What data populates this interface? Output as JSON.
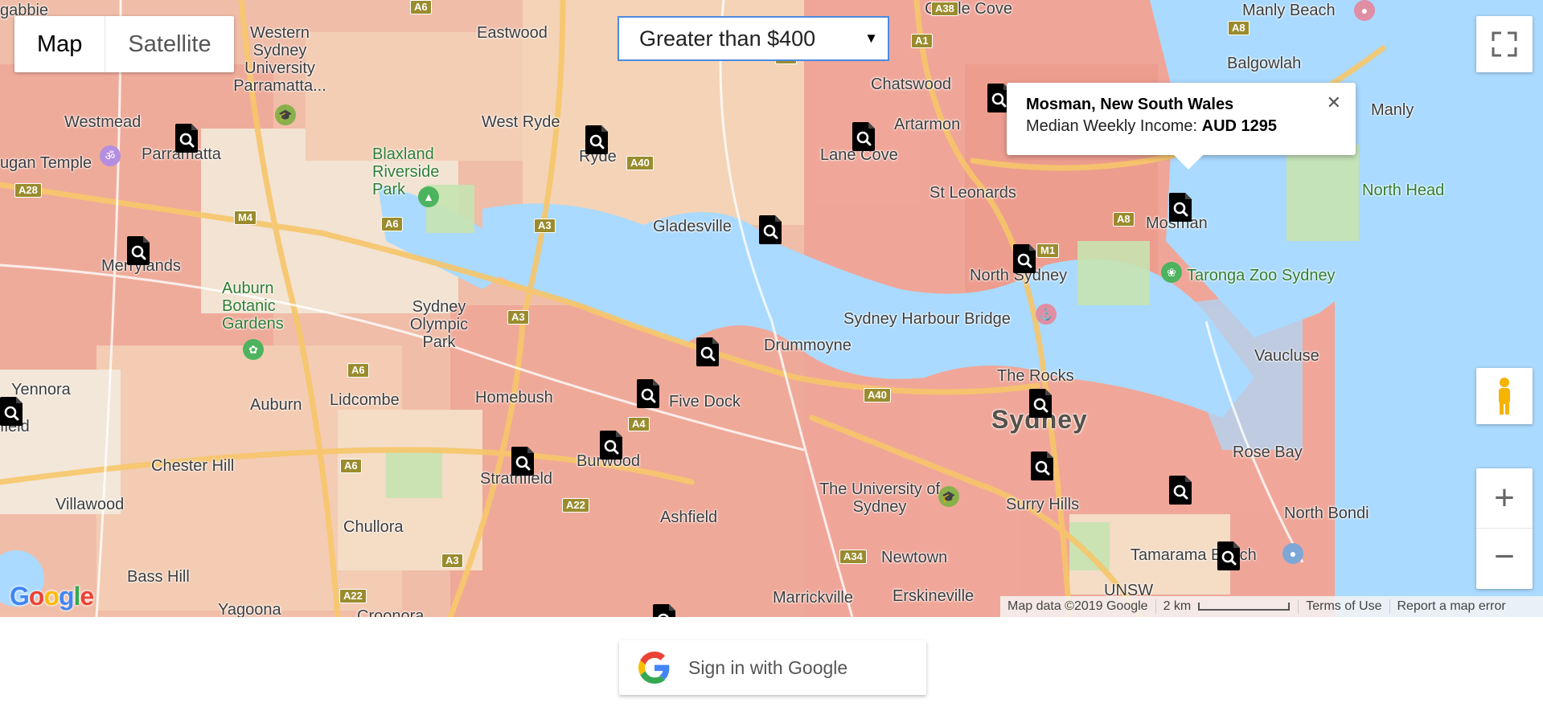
{
  "map_type_control": {
    "map_label": "Map",
    "satellite_label": "Satellite",
    "active": "Map"
  },
  "filter": {
    "selected": "Greater than $400"
  },
  "info_window": {
    "title": "Mosman, New South Wales",
    "income_label": "Median Weekly Income:",
    "income_value": "AUD 1295"
  },
  "attribution": {
    "map_data": "Map data ©2019 Google",
    "scale_label": "2 km",
    "terms": "Terms of Use",
    "report": "Report a map error"
  },
  "logo": "Google",
  "signin_label": "Sign in with Google",
  "colors": {
    "accent": "#4d8ae0",
    "high_income": "#ef9a8c",
    "water": "#aadaff"
  },
  "places": [
    {
      "name": "gabbie"
    },
    {
      "name": "Western Sydney University Parramatta..."
    },
    {
      "name": "Eastwood"
    },
    {
      "name": "Castle Cove"
    },
    {
      "name": "Manly Beach"
    },
    {
      "name": "Westmead"
    },
    {
      "name": "Parramatta"
    },
    {
      "name": "West Ryde"
    },
    {
      "name": "Ryde"
    },
    {
      "name": "Chatswood"
    },
    {
      "name": "Balgowlah"
    },
    {
      "name": "Manly"
    },
    {
      "name": "Artarmon"
    },
    {
      "name": "Lane Cove"
    },
    {
      "name": "Blaxland Riverside Park"
    },
    {
      "name": "ugan Temple"
    },
    {
      "name": "St Leonards"
    },
    {
      "name": "Mosman"
    },
    {
      "name": "North Head"
    },
    {
      "name": "Gladesville"
    },
    {
      "name": "Merrylands"
    },
    {
      "name": "North Sydney"
    },
    {
      "name": "Taronga Zoo Sydney"
    },
    {
      "name": "Auburn Botanic Gardens"
    },
    {
      "name": "Sydney Olympic Park"
    },
    {
      "name": "Sydney Harbour Bridge"
    },
    {
      "name": "Drummoyne"
    },
    {
      "name": "Vaucluse"
    },
    {
      "name": "Yennora"
    },
    {
      "name": "field"
    },
    {
      "name": "Auburn"
    },
    {
      "name": "Lidcombe"
    },
    {
      "name": "Homebush"
    },
    {
      "name": "Five Dock"
    },
    {
      "name": "The Rocks"
    },
    {
      "name": "Sydney"
    },
    {
      "name": "Chester Hill"
    },
    {
      "name": "Burwood"
    },
    {
      "name": "Strathfield"
    },
    {
      "name": "Rose Bay"
    },
    {
      "name": "Villawood"
    },
    {
      "name": "The University of Sydney"
    },
    {
      "name": "Surry Hills"
    },
    {
      "name": "North Bondi"
    },
    {
      "name": "Chullora"
    },
    {
      "name": "Ashfield"
    },
    {
      "name": "Bass Hill"
    },
    {
      "name": "Newtown"
    },
    {
      "name": "Tamarama Beach"
    },
    {
      "name": "Marrickville"
    },
    {
      "name": "Erskineville"
    },
    {
      "name": "UNSW"
    },
    {
      "name": "Yagoona"
    },
    {
      "name": "Croonora"
    }
  ],
  "road_shields": [
    "A6",
    "A38",
    "A8",
    "A1",
    "A3",
    "A40",
    "A28",
    "M4",
    "A6",
    "A3",
    "A3",
    "M1",
    "A8",
    "A6",
    "A40",
    "A4",
    "A6",
    "A22",
    "A34",
    "A3",
    "A22"
  ]
}
